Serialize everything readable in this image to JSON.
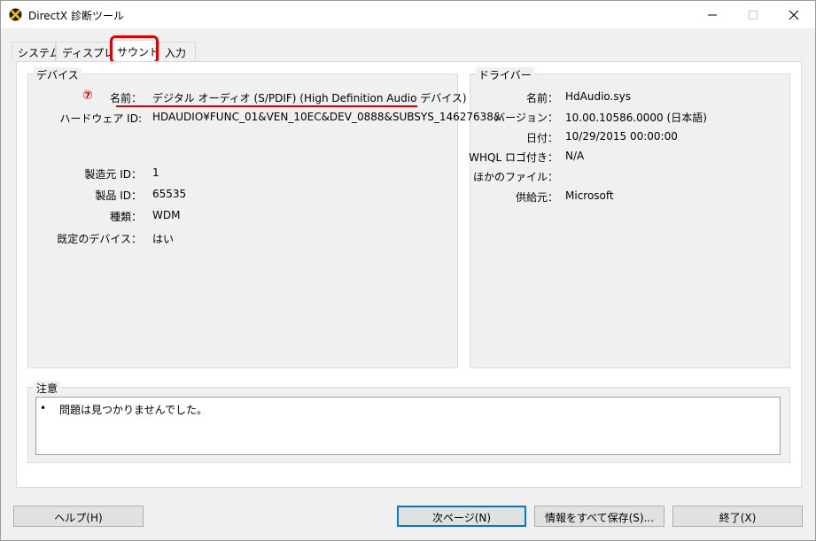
{
  "window": {
    "title": "DirectX 診断ツール"
  },
  "tabs": [
    {
      "label": "システム"
    },
    {
      "label": "ディスプレイ"
    },
    {
      "label": "サウンド"
    },
    {
      "label": "入力"
    }
  ],
  "device": {
    "group_title": "デバイス",
    "annotation": "⑦",
    "fields": [
      {
        "label": "名前：",
        "value": "デジタル オーディオ (S/PDIF) (High Definition Audio デバイス)"
      },
      {
        "label": "ハードウェア ID:",
        "value": "HDAUDIO¥FUNC_01&VEN_10EC&DEV_0888&SUBSYS_14627638&"
      },
      {
        "label": "製造元 ID：",
        "value": "1"
      },
      {
        "label": "製品 ID：",
        "value": "65535"
      },
      {
        "label": "種類：",
        "value": "WDM"
      },
      {
        "label": "既定のデバイス：",
        "value": "はい"
      }
    ]
  },
  "driver": {
    "group_title": "ドライバー",
    "fields": [
      {
        "label": "名前：",
        "value": "HdAudio.sys"
      },
      {
        "label": "バージョン：",
        "value": "10.00.10586.0000 (日本語)"
      },
      {
        "label": "日付：",
        "value": "10/29/2015 00:00:00"
      },
      {
        "label": "WHQL ロゴ付き：",
        "value": "N/A"
      },
      {
        "label": "ほかのファイル：",
        "value": ""
      },
      {
        "label": "供給元：",
        "value": "Microsoft"
      }
    ]
  },
  "notes": {
    "group_title": "注意",
    "bullet": "•",
    "text": "問題は見つかりませんでした。"
  },
  "buttons": {
    "help": "ヘルプ(H)",
    "next_page": "次ページ(N)",
    "save_all": "情報をすべて保存(S)...",
    "exit": "終了(X)"
  },
  "colors": {
    "highlight": "#e00000",
    "focus": "#0078d7"
  },
  "icons": [
    "directx-icon",
    "minimize-icon",
    "maximize-icon",
    "close-icon"
  ]
}
